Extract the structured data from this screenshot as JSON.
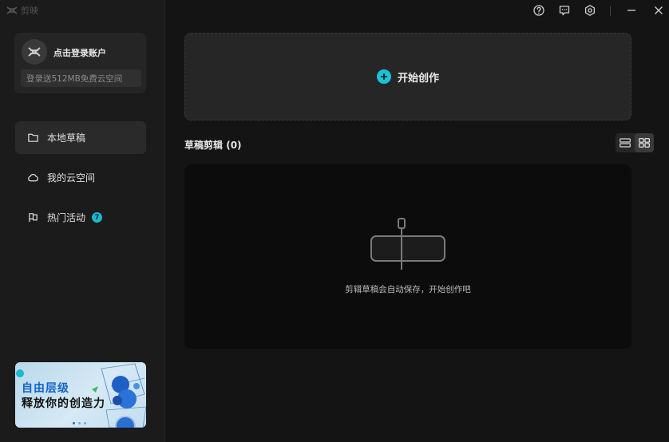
{
  "app": {
    "name": "剪映"
  },
  "account": {
    "login_label": "点击登录账户",
    "promo_text": "登录送512MB免费云空间"
  },
  "nav": {
    "items": [
      {
        "label": "本地草稿",
        "icon": "folder-icon",
        "active": true
      },
      {
        "label": "我的云空间",
        "icon": "cloud-icon",
        "active": false
      },
      {
        "label": "热门活动",
        "icon": "flag-icon",
        "active": false,
        "badge": "7"
      }
    ]
  },
  "banner": {
    "line1": "自由层级",
    "line2": "释放你的创造力"
  },
  "titlebar": {
    "icons": [
      "help-icon",
      "feedback-icon",
      "settings-icon",
      "minimize-icon",
      "close-icon"
    ]
  },
  "main": {
    "create_label": "开始创作",
    "section_title": "草稿剪辑",
    "section_count": "(0)",
    "empty_text": "剪辑草稿会自动保存，开始创作吧",
    "view_modes": [
      "list-view-icon",
      "grid-view-icon"
    ]
  },
  "colors": {
    "accent": "#1bc2d6",
    "background": "#141414",
    "sidebar": "#1b1b1b",
    "card": "#262626"
  }
}
